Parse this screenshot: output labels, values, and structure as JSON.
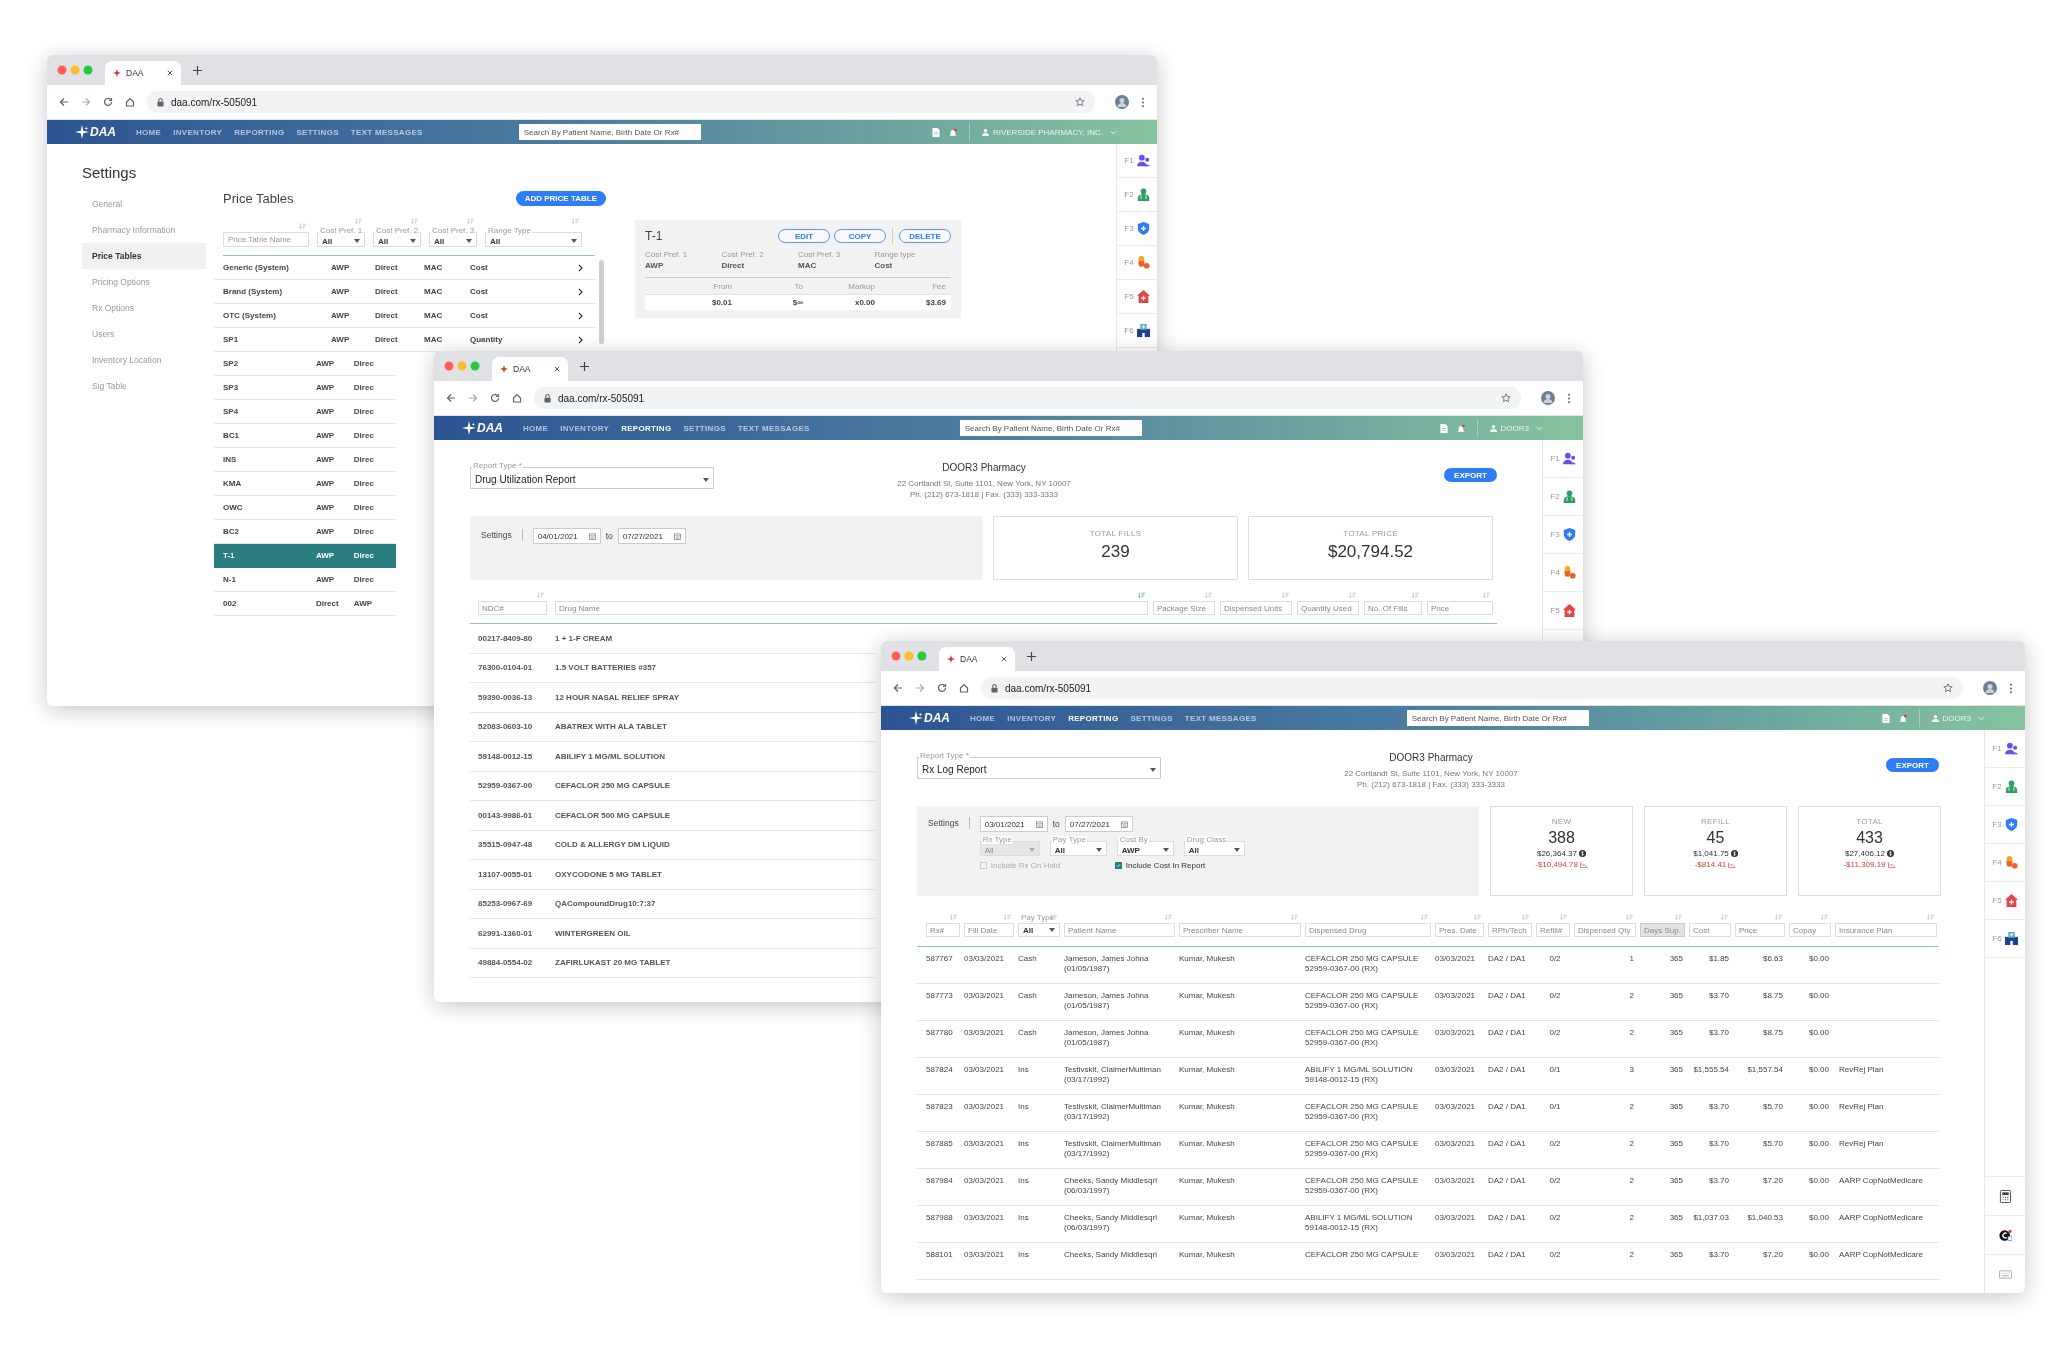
{
  "windows": [
    {
      "kind": "price_tables",
      "tab_title": "DAA",
      "url": "daa.com/rx-505091",
      "logo": "DAA",
      "nav": [
        {
          "label": "HOME",
          "selected": false
        },
        {
          "label": "INVENTORY",
          "selected": false
        },
        {
          "label": "REPORTING",
          "selected": false
        },
        {
          "label": "SETTINGS",
          "selected": false
        },
        {
          "label": "TEXT MESSAGES",
          "selected": false
        }
      ],
      "search_placeholder": "Search By Patient Name, Birth Date Or Rx#",
      "account": "RIVERSIDE PHARMACY, INC.",
      "shortcuts": [
        "F1",
        "F2",
        "F3",
        "F4",
        "F5",
        "F6"
      ],
      "title": "Settings",
      "menu": [
        {
          "label": "General",
          "selected": false
        },
        {
          "label": "Pharmacy Information",
          "selected": false
        },
        {
          "label": "Price Tables",
          "selected": true
        },
        {
          "label": "Pricing Options",
          "selected": false
        },
        {
          "label": "Rx Options",
          "selected": false
        },
        {
          "label": "Users",
          "selected": false
        },
        {
          "label": "Inventory Location",
          "selected": false
        },
        {
          "label": "Sig Table",
          "selected": false
        }
      ],
      "heading": "Price Tables",
      "add_button": "ADD PRICE TABLE",
      "filters": [
        {
          "kind": "field",
          "placeholder": "Price Table Name"
        },
        {
          "kind": "select",
          "label": "Cost Pref. 1",
          "value": "All"
        },
        {
          "kind": "select",
          "label": "Cost Pref. 2",
          "value": "All"
        },
        {
          "kind": "select",
          "label": "Cost Pref. 3",
          "value": "All"
        },
        {
          "kind": "select",
          "label": "Range Type",
          "value": "All"
        }
      ],
      "rows": [
        {
          "cells": [
            "Generic (System)",
            "AWP",
            "Direct",
            "MAC",
            "Cost"
          ],
          "selected": false
        },
        {
          "cells": [
            "Brand (System)",
            "AWP",
            "Direct",
            "MAC",
            "Cost"
          ],
          "selected": false
        },
        {
          "cells": [
            "OTC (System)",
            "AWP",
            "Direct",
            "MAC",
            "Cost"
          ],
          "selected": false
        },
        {
          "cells": [
            "SP1",
            "AWP",
            "Direct",
            "MAC",
            "Quantity"
          ],
          "selected": false
        },
        {
          "cells": [
            "SP2",
            "AWP",
            "Direc"
          ],
          "selected": false
        },
        {
          "cells": [
            "SP3",
            "AWP",
            "Direc"
          ],
          "selected": false
        },
        {
          "cells": [
            "SP4",
            "AWP",
            "Direc"
          ],
          "selected": false
        },
        {
          "cells": [
            "BC1",
            "AWP",
            "Direc"
          ],
          "selected": false
        },
        {
          "cells": [
            "INS",
            "AWP",
            "Direc"
          ],
          "selected": false
        },
        {
          "cells": [
            "KMA",
            "AWP",
            "Direc"
          ],
          "selected": false
        },
        {
          "cells": [
            "OWC",
            "AWP",
            "Direc"
          ],
          "selected": false
        },
        {
          "cells": [
            "BC2",
            "AWP",
            "Direc"
          ],
          "selected": false
        },
        {
          "cells": [
            "T-1",
            "AWP",
            "Direc"
          ],
          "selected": true
        },
        {
          "cells": [
            "N-1",
            "AWP",
            "Direc"
          ],
          "selected": false
        },
        {
          "cells": [
            "002",
            "Direct",
            "AWP"
          ],
          "selected": false
        }
      ],
      "detail": {
        "title": "T-1",
        "buttons": [
          "EDIT",
          "COPY",
          "DELETE"
        ],
        "fields": [
          {
            "label": "Cost Pref. 1",
            "value": "AWP"
          },
          {
            "label": "Cost Pref. 2",
            "value": "Direct"
          },
          {
            "label": "Cost Pref. 3",
            "value": "MAC"
          },
          {
            "label": "Range type",
            "value": "Cost"
          }
        ],
        "columns": [
          "From",
          "To",
          "Markup",
          "Fee"
        ],
        "row": [
          "$0.01",
          "$∞",
          "x0.00",
          "$3.69"
        ]
      }
    },
    {
      "kind": "drug_utilization",
      "tab_title": "DAA",
      "url": "daa.com/rx-505091",
      "logo": "DAA",
      "nav": [
        {
          "label": "HOME",
          "selected": false
        },
        {
          "label": "INVENTORY",
          "selected": false
        },
        {
          "label": "REPORTING",
          "selected": true
        },
        {
          "label": "SETTINGS",
          "selected": false
        },
        {
          "label": "TEXT MESSAGES",
          "selected": false
        }
      ],
      "search_placeholder": "Search By Patient Name, Birth Date Or Rx#",
      "account": "DOOR3",
      "shortcuts": [
        "F1",
        "F2",
        "F3",
        "F4",
        "F5"
      ],
      "report_type": {
        "label": "Report Type *",
        "value": "Drug Utilization Report"
      },
      "pharmacy": {
        "name": "DOOR3 Pharmacy",
        "address": "22 Cortlandt St, Suite 1101, New York, NY 10007",
        "contact": "Ph. (212) 673-1818 | Fax. (333) 333-3333"
      },
      "export_button": "EXPORT",
      "settings": {
        "label": "Settings",
        "from": "04/01/2021",
        "to_label": "to",
        "to": "07/27/2021"
      },
      "stats": [
        {
          "label": "TOTAL FILLS",
          "value": "239"
        },
        {
          "label": "TOTAL PRICE",
          "value": "$20,794.52"
        }
      ],
      "columns": [
        {
          "placeholder": "NDC#"
        },
        {
          "placeholder": "Drug Name"
        },
        {
          "placeholder": "Package Size"
        },
        {
          "placeholder": "Dispensed Units"
        },
        {
          "placeholder": "Quantity Used"
        },
        {
          "placeholder": "No. Of Fills"
        },
        {
          "placeholder": "Price"
        }
      ],
      "rows": [
        {
          "ndc": "00217-8409-80",
          "drug": "1 + 1-F CREAM"
        },
        {
          "ndc": "76300-0104-01",
          "drug": "1.5 VOLT BATTERIES #357"
        },
        {
          "ndc": "59390-0036-13",
          "drug": "12 HOUR NASAL RELIEF SPRAY"
        },
        {
          "ndc": "52083-0603-10",
          "drug": "ABATREX WITH ALA TABLET"
        },
        {
          "ndc": "59148-0012-15",
          "drug": "ABILIFY 1 MG/ML SOLUTION"
        },
        {
          "ndc": "52959-0367-00",
          "drug": "CEFACLOR 250 MG CAPSULE"
        },
        {
          "ndc": "00143-9986-01",
          "drug": "CEFACLOR 500 MG CAPSULE"
        },
        {
          "ndc": "35515-0947-48",
          "drug": "COLD & ALLERGY DM LIQUID"
        },
        {
          "ndc": "13107-0055-01",
          "drug": "OXYCODONE 5 MG TABLET"
        },
        {
          "ndc": "85253-0967-69",
          "drug": "QACompoundDrug10:7:37"
        },
        {
          "ndc": "62991-1360-01",
          "drug": "WINTERGREEN OIL"
        },
        {
          "ndc": "49884-0554-02",
          "drug": "ZAFIRLUKAST 20 MG TABLET"
        }
      ]
    },
    {
      "kind": "rx_log",
      "tab_title": "DAA",
      "url": "daa.com/rx-505091",
      "logo": "DAA",
      "nav": [
        {
          "label": "HOME",
          "selected": false
        },
        {
          "label": "INVENTORY",
          "selected": false
        },
        {
          "label": "REPORTING",
          "selected": true
        },
        {
          "label": "SETTINGS",
          "selected": false
        },
        {
          "label": "TEXT MESSAGES",
          "selected": false
        }
      ],
      "search_placeholder": "Search By Patient Name, Birth Date Or Rx#",
      "account": "DOOR3",
      "shortcuts": [
        "F1",
        "F2",
        "F3",
        "F4",
        "F5",
        "F6"
      ],
      "report_type": {
        "label": "Report Type *",
        "value": "Rx Log Report"
      },
      "pharmacy": {
        "name": "DOOR3 Pharmacy",
        "address": "22 Cortlandt St, Suite 1101, New York, NY 10007",
        "contact": "Ph. (212) 673-1818 | Fax. (333) 333-3333"
      },
      "export_button": "EXPORT",
      "settings": {
        "label": "Settings",
        "from": "03/01/2021",
        "to_label": "to",
        "to": "07/27/2021",
        "selects": [
          {
            "label": "Rx Type",
            "value": "All",
            "disabled": true
          },
          {
            "label": "Pay Type",
            "value": "All",
            "disabled": false
          },
          {
            "label": "Cost By",
            "value": "AWP",
            "disabled": false
          },
          {
            "label": "Drug Class",
            "value": "All",
            "disabled": false
          }
        ],
        "checkboxes": [
          {
            "label": "Include Rx On Hold",
            "checked": false,
            "disabled": true
          },
          {
            "label": "Include Cost In Report",
            "checked": true,
            "disabled": false
          }
        ]
      },
      "stats": [
        {
          "label": "NEW",
          "count": "388",
          "amount": "$26,364.37",
          "delta": "-$10,494.78"
        },
        {
          "label": "REFILL",
          "count": "45",
          "amount": "$1,041.75",
          "delta": "-$814.41"
        },
        {
          "label": "TOTAL",
          "count": "433",
          "amount": "$27,406.12",
          "delta": "-$11,309.19"
        }
      ],
      "columns": [
        {
          "kind": "field",
          "placeholder": "Rx#",
          "selected": false
        },
        {
          "kind": "field",
          "placeholder": "Fill Date",
          "selected": false
        },
        {
          "kind": "select",
          "label": "Pay Type",
          "value": "All",
          "selected": false
        },
        {
          "kind": "field",
          "placeholder": "Patient Name",
          "selected": false
        },
        {
          "kind": "field",
          "placeholder": "Prescriber Name",
          "selected": false
        },
        {
          "kind": "field",
          "placeholder": "Dispensed Drug",
          "selected": false
        },
        {
          "kind": "field",
          "placeholder": "Pres. Date",
          "selected": false
        },
        {
          "kind": "field",
          "placeholder": "RPh/Tech",
          "selected": false
        },
        {
          "kind": "field",
          "placeholder": "Refill#",
          "selected": false
        },
        {
          "kind": "field",
          "placeholder": "Dispensed Qty",
          "selected": false
        },
        {
          "kind": "field",
          "placeholder": "Days Sup.",
          "selected": true
        },
        {
          "kind": "field",
          "placeholder": "Cost",
          "selected": false
        },
        {
          "kind": "field",
          "placeholder": "Price",
          "selected": false
        },
        {
          "kind": "field",
          "placeholder": "Copay",
          "selected": false
        },
        {
          "kind": "field",
          "placeholder": "Insurance Plan",
          "selected": false
        }
      ],
      "rows": [
        {
          "rx": "587767",
          "fill_date": "03/03/2021",
          "pay_type": "Cash",
          "patient": [
            "Jameson, James Johna",
            "(01/05/1987)"
          ],
          "prescriber": "Kumar, Mukesh",
          "drug": [
            "CEFACLOR 250 MG CAPSULE",
            "52959-0367-00 (RX)"
          ],
          "pres_date": "03/03/2021",
          "rph_tech": "DA2 / DA1",
          "refill": "0/2",
          "qty": "1",
          "days": "365",
          "cost": "$1.85",
          "price": "$6.63",
          "copay": "$0.00"
        },
        {
          "rx": "587773",
          "fill_date": "03/03/2021",
          "pay_type": "Cash",
          "patient": [
            "Jameson, James Johna",
            "(01/05/1987)"
          ],
          "prescriber": "Kumar, Mukesh",
          "drug": [
            "CEFACLOR 250 MG CAPSULE",
            "52959-0367-00 (RX)"
          ],
          "pres_date": "03/03/2021",
          "rph_tech": "DA2 / DA1",
          "refill": "0/2",
          "qty": "2",
          "days": "365",
          "cost": "$3.70",
          "price": "$8.75",
          "copay": "$0.00"
        },
        {
          "rx": "587780",
          "fill_date": "03/03/2021",
          "pay_type": "Cash",
          "patient": [
            "Jameson, James Johna",
            "(01/05/1987)"
          ],
          "prescriber": "Kumar, Mukesh",
          "drug": [
            "CEFACLOR 250 MG CAPSULE",
            "52959-0367-00 (RX)"
          ],
          "pres_date": "03/03/2021",
          "rph_tech": "DA2 / DA1",
          "refill": "0/2",
          "qty": "2",
          "days": "365",
          "cost": "$3.70",
          "price": "$8.75",
          "copay": "$0.00"
        },
        {
          "rx": "587824",
          "fill_date": "03/03/2021",
          "pay_type": "Ins",
          "patient": [
            "Testivskit, ClaimerMultiman",
            "(03/17/1992)"
          ],
          "prescriber": "Kumar, Mukesh",
          "drug": [
            "ABILIFY 1 MG/ML SOLUTION",
            "59148-0012-15 (RX)"
          ],
          "pres_date": "03/03/2021",
          "rph_tech": "DA2 / DA1",
          "refill": "0/1",
          "qty": "3",
          "days": "365",
          "cost": "$1,555.54",
          "price": "$1,557.54",
          "copay": "$0.00",
          "plan": "RevRej Plan"
        },
        {
          "rx": "587823",
          "fill_date": "03/03/2021",
          "pay_type": "Ins",
          "patient": [
            "Testivskit, ClaimerMultiman",
            "(03/17/1992)"
          ],
          "prescriber": "Kumar, Mukesh",
          "drug": [
            "CEFACLOR 250 MG CAPSULE",
            "52959-0367-00 (RX)"
          ],
          "pres_date": "03/03/2021",
          "rph_tech": "DA2 / DA1",
          "refill": "0/1",
          "qty": "2",
          "days": "365",
          "cost": "$3.70",
          "price": "$5.70",
          "copay": "$0.00",
          "plan": "RevRej Plan"
        },
        {
          "rx": "587885",
          "fill_date": "03/03/2021",
          "pay_type": "Ins",
          "patient": [
            "Testivskit, ClaimerMultiman",
            "(03/17/1992)"
          ],
          "prescriber": "Kumar, Mukesh",
          "drug": [
            "CEFACLOR 250 MG CAPSULE",
            "52959-0367-00 (RX)"
          ],
          "pres_date": "03/03/2021",
          "rph_tech": "DA2 / DA1",
          "refill": "0/2",
          "qty": "2",
          "days": "365",
          "cost": "$3.70",
          "price": "$5.70",
          "copay": "$0.00",
          "plan": "RevRej Plan"
        },
        {
          "rx": "587984",
          "fill_date": "03/03/2021",
          "pay_type": "Ins",
          "patient": [
            "Cheeks, Sandy Middlesqrl",
            "(06/03/1997)"
          ],
          "prescriber": "Kumar, Mukesh",
          "drug": [
            "CEFACLOR 250 MG CAPSULE",
            "52959-0367-00 (RX)"
          ],
          "pres_date": "03/03/2021",
          "rph_tech": "DA2 / DA1",
          "refill": "0/2",
          "qty": "2",
          "days": "365",
          "cost": "$3.70",
          "price": "$7.20",
          "copay": "$0.00",
          "plan": "AARP CopNotMedicare"
        },
        {
          "rx": "587988",
          "fill_date": "03/03/2021",
          "pay_type": "Ins",
          "patient": [
            "Cheeks, Sandy Middlesqrl",
            "(06/03/1997)"
          ],
          "prescriber": "Kumar, Mukesh",
          "drug": [
            "ABILIFY 1 MG/ML SOLUTION",
            "59148-0012-15 (RX)"
          ],
          "pres_date": "03/03/2021",
          "rph_tech": "DA2 / DA1",
          "refill": "0/2",
          "qty": "2",
          "days": "365",
          "cost": "$1,037.03",
          "price": "$1,040.53",
          "copay": "$0.00",
          "plan": "AARP CopNotMedicare"
        },
        {
          "rx": "588101",
          "fill_date": "03/03/2021",
          "pay_type": "Ins",
          "patient": [
            "Cheeks, Sandy Middlesqrl"
          ],
          "prescriber": "Kumar, Mukesh",
          "drug": [
            "CEFACLOR 250 MG CAPSULE"
          ],
          "pres_date": "03/03/2021",
          "rph_tech": "DA2 / DA1",
          "refill": "0/2",
          "qty": "2",
          "days": "365",
          "cost": "$3.70",
          "price": "$7.20",
          "copay": "$0.00",
          "plan": "AARP CopNotMedicare"
        }
      ]
    }
  ]
}
